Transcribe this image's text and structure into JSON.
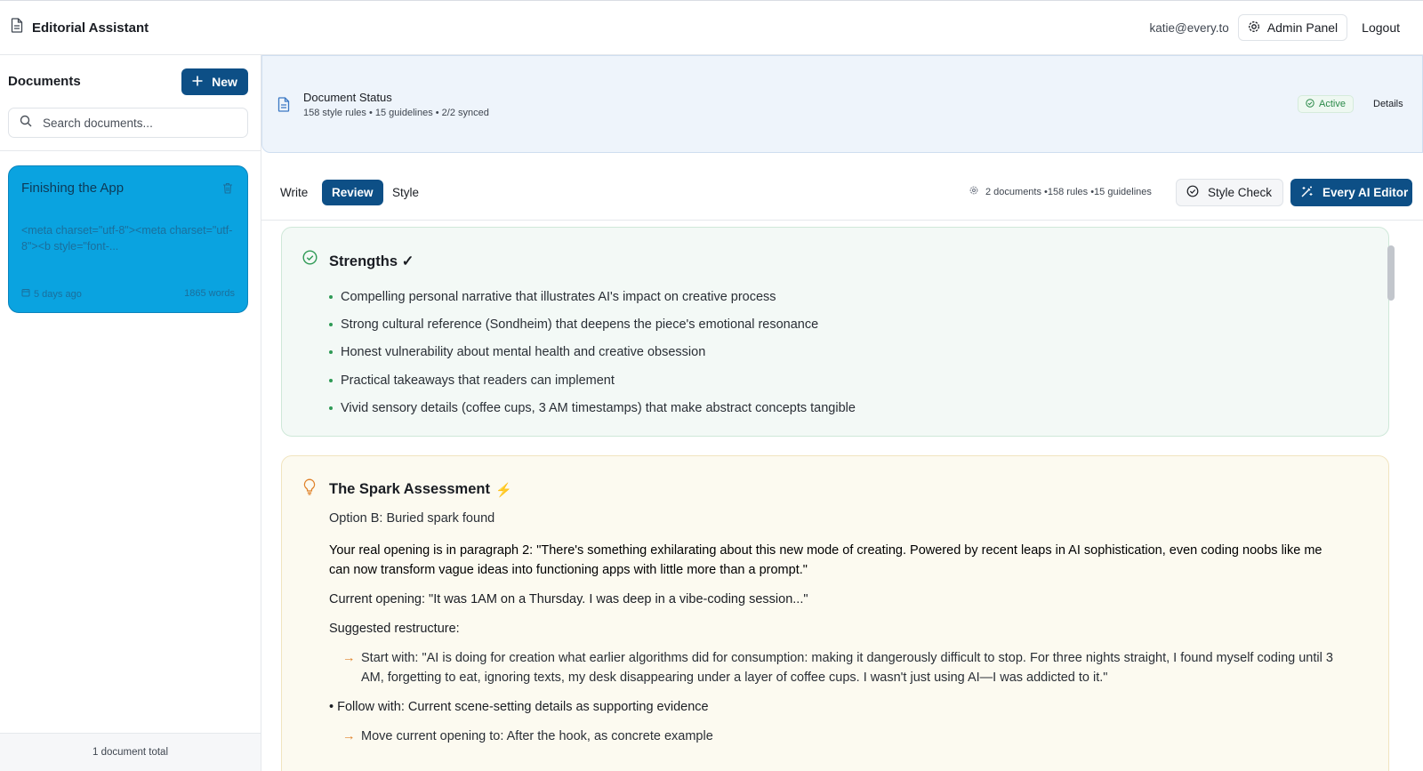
{
  "header": {
    "app_title": "Editorial Assistant",
    "user_email": "katie@every.to",
    "admin_label": "Admin Panel",
    "logout_label": "Logout"
  },
  "sidebar": {
    "title": "Documents",
    "new_label": "New",
    "search_placeholder": "Search documents...",
    "documents": [
      {
        "title": "Finishing the App",
        "snippet": "<meta charset=\"utf-8\"><meta charset=\"utf-8\"><b style=\"font-...",
        "updated": "5 days ago",
        "words": "1865 words"
      }
    ],
    "footer": "1 document total"
  },
  "status": {
    "title": "Document Status",
    "subtitle": "158 style rules • 15 guidelines • 2/2 synced",
    "badge": "Active",
    "details_label": "Details"
  },
  "tabs": {
    "items": [
      "Write",
      "Review",
      "Style"
    ],
    "active": "Review",
    "stats": "2 documents •158 rules •15 guidelines",
    "style_check_label": "Style Check",
    "ai_editor_label": "Every AI Editor"
  },
  "strengths": {
    "heading": "Strengths ✓",
    "items": [
      "Compelling personal narrative that illustrates AI's impact on creative process",
      "Strong cultural reference (Sondheim) that deepens the piece's emotional resonance",
      "Honest vulnerability about mental health and creative obsession",
      "Practical takeaways that readers can implement",
      "Vivid sensory details (coffee cups, 3 AM timestamps) that make abstract concepts tangible"
    ]
  },
  "spark": {
    "heading": "The Spark Assessment",
    "heading_emoji": "⚡",
    "option": "Option B: Buried spark found",
    "real_opening": "Your real opening is in paragraph 2: \"There's something exhilarating about this new mode of creating. Powered by recent leaps in AI sophistication, even coding noobs like me can now transform vague ideas into functioning apps with little more than a prompt.\"",
    "current_opening": "Current opening: \"It was 1AM on a Thursday. I was deep in a vibe-coding session...\"",
    "suggested_label": "Suggested restructure:",
    "start_with": "Start with: \"AI is doing for creation what earlier algorithms did for consumption: making it dangerously difficult to stop. For three nights straight, I found myself coding until 3 AM, forgetting to eat, ignoring texts, my desk disappearing under a layer of coffee cups. I wasn't just using AI—I was addicted to it.\"",
    "follow_with": "• Follow with: Current scene-setting details as supporting evidence",
    "move_current": "Move current opening to: After the hook, as concrete example",
    "arrow_glyph": "→"
  },
  "colors": {
    "primary": "#0d4f86",
    "card_selected": "#0aa3e0",
    "success": "#2e9a55",
    "warning": "#e0822a"
  }
}
